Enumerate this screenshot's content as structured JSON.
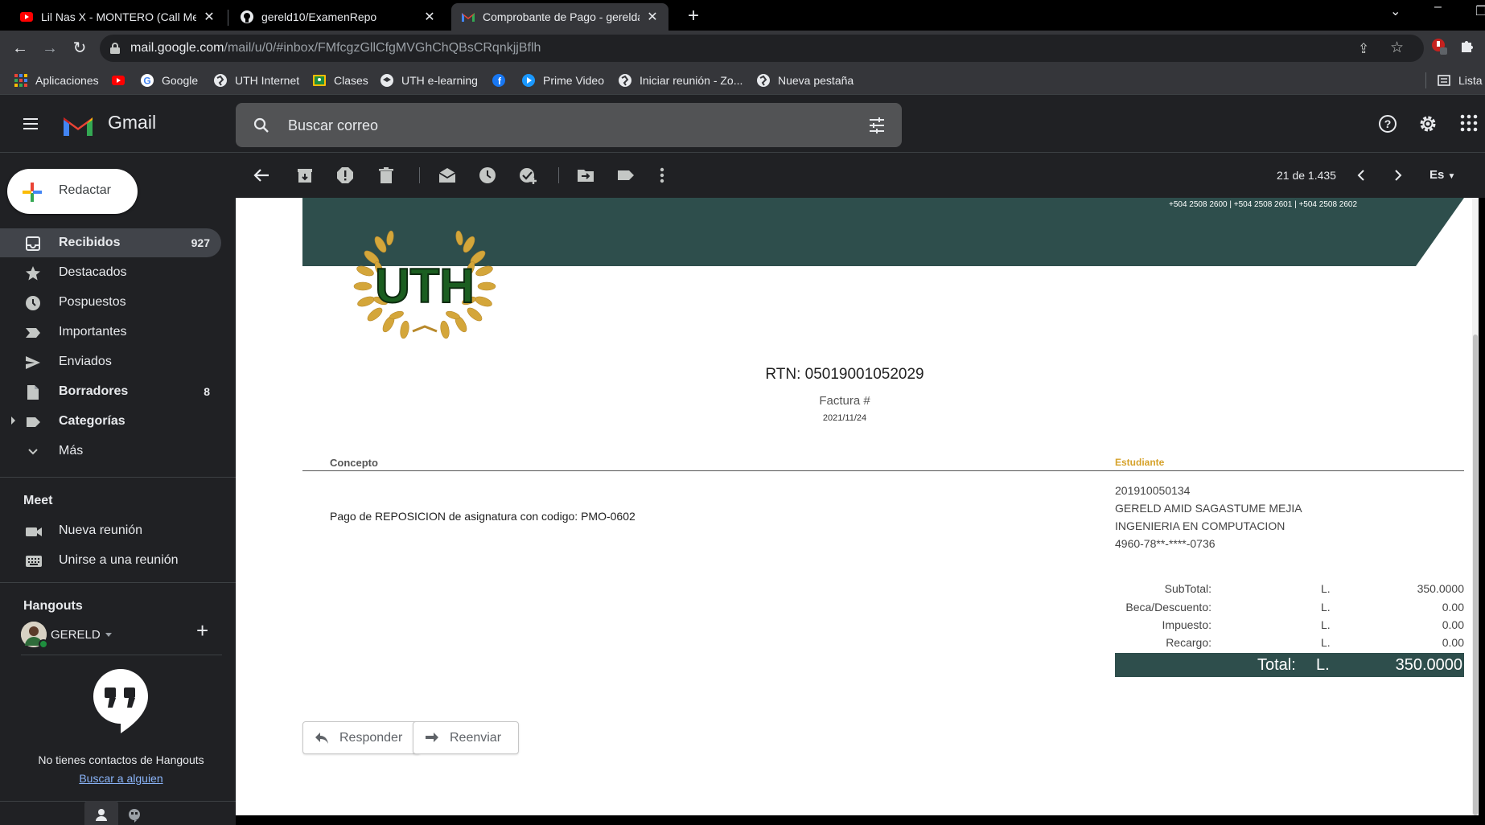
{
  "browser": {
    "tabs": [
      {
        "title": "Lil Nas X - MONTERO (Call Me By",
        "favicon": "youtube-icon"
      },
      {
        "title": "gereld10/ExamenRepo",
        "favicon": "github-icon"
      },
      {
        "title": "Comprobante de Pago - gereldan",
        "favicon": "gmail-icon",
        "active": true
      }
    ],
    "url_host": "mail.google.com",
    "url_path": "/mail/u/0/#inbox/FMfcgzGllCfgMVGhChQBsCRqnkjjBflh",
    "bookmarks": [
      {
        "label": "Aplicaciones",
        "icon": "apps-grid-icon"
      },
      {
        "label": "",
        "icon": "youtube-icon"
      },
      {
        "label": "Google",
        "icon": "google-icon"
      },
      {
        "label": "UTH Internet",
        "icon": "globe-icon"
      },
      {
        "label": "Clases",
        "icon": "classroom-icon"
      },
      {
        "label": "UTH e-learning",
        "icon": "elearning-icon"
      },
      {
        "label": "",
        "icon": "facebook-icon"
      },
      {
        "label": "Prime Video",
        "icon": "prime-video-icon"
      },
      {
        "label": "Iniciar reunión - Zo...",
        "icon": "globe-icon"
      },
      {
        "label": "Nueva pestaña",
        "icon": "globe-icon"
      }
    ],
    "reading_list_label": "Lista d"
  },
  "gmail": {
    "wordmark": "Gmail",
    "search_placeholder": "Buscar correo",
    "compose_label": "Redactar",
    "nav": [
      {
        "label": "Recibidos",
        "count": "927",
        "bold": true,
        "active": true,
        "icon": "inbox-icon"
      },
      {
        "label": "Destacados",
        "count": "",
        "bold": false,
        "icon": "star-icon"
      },
      {
        "label": "Pospuestos",
        "count": "",
        "bold": false,
        "icon": "clock-icon"
      },
      {
        "label": "Importantes",
        "count": "",
        "bold": false,
        "icon": "important-icon"
      },
      {
        "label": "Enviados",
        "count": "",
        "bold": false,
        "icon": "send-icon"
      },
      {
        "label": "Borradores",
        "count": "8",
        "bold": true,
        "icon": "draft-icon"
      },
      {
        "label": "Categorías",
        "count": "",
        "bold": true,
        "icon": "label-icon"
      },
      {
        "label": "Más",
        "count": "",
        "bold": false,
        "icon": "chevron-down-icon"
      }
    ],
    "meet": {
      "heading": "Meet",
      "items": [
        {
          "label": "Nueva reunión",
          "icon": "video-icon"
        },
        {
          "label": "Unirse a una reunión",
          "icon": "keyboard-icon"
        }
      ]
    },
    "hangouts": {
      "heading": "Hangouts",
      "user": "GERELD",
      "empty_text": "No tienes contactos de Hangouts",
      "find_link": "Buscar a alguien"
    },
    "toolbar": {
      "pager": "21 de 1.435",
      "language": "Es"
    }
  },
  "receipt": {
    "phones": "+504 2508 2600 | +504 2508 2601 | +504 2508 2602",
    "logo_text": "UTH",
    "rtn": "RTN: 05019001052029",
    "factura": "Factura #",
    "fecha": "2021/11/24",
    "col_concepto": "Concepto",
    "col_estudiante": "Estudiante",
    "concepto": "Pago de REPOSICION de asignatura con codigo: PMO-0602",
    "estudiante": [
      "201910050134",
      "GERELD AMID SAGASTUME MEJIA",
      "INGENIERIA EN COMPUTACION",
      "4960-78**-****-0736"
    ],
    "totals": [
      {
        "label": "SubTotal:",
        "currency": "L.",
        "value": "350.0000"
      },
      {
        "label": "Beca/Descuento:",
        "currency": "L.",
        "value": "0.00"
      },
      {
        "label": "Impuesto:",
        "currency": "L.",
        "value": "0.00"
      },
      {
        "label": "Recargo:",
        "currency": "L.",
        "value": "0.00"
      }
    ],
    "total": {
      "label": "Total:",
      "currency": "L.",
      "value": "350.0000"
    },
    "colors": {
      "banner": "#2e4e4c",
      "accent": "#d6a22a"
    }
  },
  "actions": {
    "reply": "Responder",
    "forward": "Reenviar"
  }
}
